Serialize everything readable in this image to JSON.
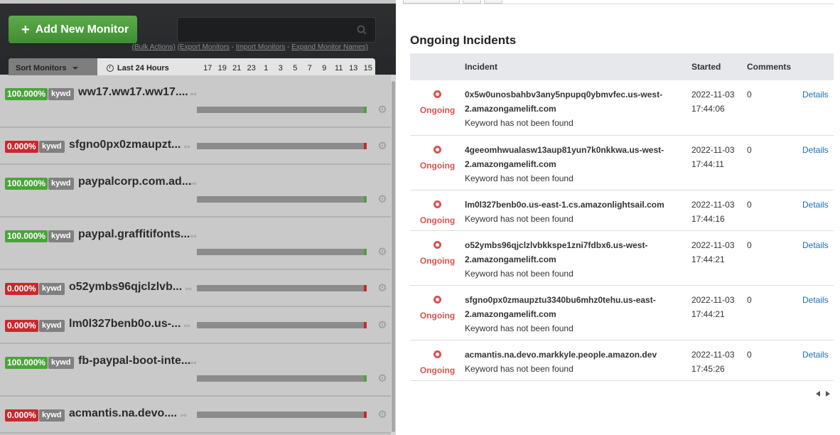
{
  "toolbar": {
    "add_label": "Add New Monitor",
    "bulk_actions": "(Bulk Actions)",
    "export": "(Export Monitors",
    "import": "Import Monitors",
    "expand": "Expand Monitor Names)",
    "sort_label": "Sort Monitors",
    "range_label": "Last 24 Hours",
    "hours": [
      "17",
      "19",
      "21",
      "23",
      "1",
      "3",
      "5",
      "7",
      "9",
      "11",
      "13",
      "15"
    ]
  },
  "monitors": [
    {
      "pct": "100.000%",
      "status": "up",
      "type": "kywd",
      "name": "ww17.ww17.ww17...."
    },
    {
      "pct": "0.000%",
      "status": "down",
      "type": "kywd",
      "name": "sfgno0px0zmaupzt..."
    },
    {
      "pct": "100.000%",
      "status": "up",
      "type": "kywd",
      "name": "paypalcorp.com.ad..."
    },
    {
      "pct": "100.000%",
      "status": "up",
      "type": "kywd",
      "name": "paypal.graffitifonts..."
    },
    {
      "pct": "0.000%",
      "status": "down",
      "type": "kywd",
      "name": "o52ymbs96qjclzlvb..."
    },
    {
      "pct": "0.000%",
      "status": "down",
      "type": "kywd",
      "name": "lm0l327benb0o.us-..."
    },
    {
      "pct": "100.000%",
      "status": "up",
      "type": "kywd",
      "name": "fb-paypal-boot-inte..."
    },
    {
      "pct": "0.000%",
      "status": "down",
      "type": "kywd",
      "name": "acmantis.na.devo...."
    }
  ],
  "incidents": {
    "title": "Ongoing Incidents",
    "headers": {
      "incident": "Incident",
      "started": "Started",
      "comments": "Comments"
    },
    "details_label": "Details",
    "rows": [
      {
        "status": "Ongoing",
        "host1": "0x5w0unosbahbv3any5npupq0ybmvfec.us-west-",
        "host2": "2.amazongamelift.com",
        "desc": "Keyword has not been found",
        "date": "2022-11-03",
        "time": "17:44:06",
        "comments": "0"
      },
      {
        "status": "Ongoing",
        "host1": "4geeomhwualasw13aup81yun7k0nkkwa.us-west-",
        "host2": "2.amazongamelift.com",
        "desc": "Keyword has not been found",
        "date": "2022-11-03",
        "time": "17:44:11",
        "comments": "0"
      },
      {
        "status": "Ongoing",
        "host1": "lm0l327benb0o.us-east-1.cs.amazonlightsail.com",
        "host2": "",
        "desc": "Keyword has not been found",
        "date": "2022-11-03",
        "time": "17:44:16",
        "comments": "0"
      },
      {
        "status": "Ongoing",
        "host1": "o52ymbs96qjclzlvbkkspe1zni7fdbx6.us-west-",
        "host2": "2.amazongamelift.com",
        "desc": "Keyword has not been found",
        "date": "2022-11-03",
        "time": "17:44:21",
        "comments": "0"
      },
      {
        "status": "Ongoing",
        "host1": "sfgno0px0zmaupztu3340bu6mhz0tehu.us-east-",
        "host2": "2.amazongamelift.com",
        "desc": "Keyword has not been found",
        "date": "2022-11-03",
        "time": "17:44:21",
        "comments": "0"
      },
      {
        "status": "Ongoing",
        "host1": "acmantis.na.devo.markkyle.people.amazon.dev",
        "host2": "",
        "desc": "Keyword has not been found",
        "date": "2022-11-03",
        "time": "17:45:26",
        "comments": "0"
      }
    ]
  },
  "colors": {
    "up": "#4ba33b",
    "down": "#c9282d",
    "link": "#1a6fb5",
    "ongoing": "#d9534f"
  },
  "icons": [
    "plus-icon",
    "search-icon",
    "caret-down-icon",
    "clock-icon",
    "link-icon",
    "gear-icon",
    "status-dot-icon",
    "prev-page-icon",
    "next-page-icon"
  ]
}
